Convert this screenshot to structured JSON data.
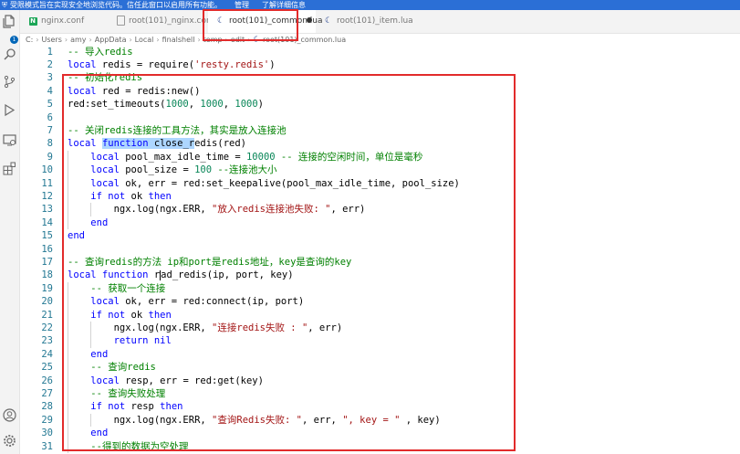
{
  "banner": {
    "message": "受限模式旨在实现安全地浏览代码。信任此窗口以启用所有功能。",
    "manage": "管理",
    "learn_more": "了解详细信息"
  },
  "activity_bar": {
    "badge": "1",
    "icons": [
      "files-icon",
      "search-icon",
      "source-control-icon",
      "run-debug-icon",
      "remote-explorer-icon",
      "extensions-icon",
      "account-icon",
      "settings-gear-icon"
    ]
  },
  "tabs": [
    {
      "label": "nginx.conf",
      "icon": "nginx-icon",
      "active": false
    },
    {
      "label": "root(101)_nginx.conf",
      "icon": "file-icon",
      "active": false
    },
    {
      "label": "root(101)_common.lua",
      "icon": "lua-icon",
      "active": true,
      "modified": true
    },
    {
      "label": "root(101)_item.lua",
      "icon": "lua-icon",
      "active": false
    }
  ],
  "breadcrumb": [
    "C:",
    "Users",
    "amy",
    "AppData",
    "Local",
    "finalshell",
    "temp",
    "edit",
    "root(101)_common.lua"
  ],
  "colors": {
    "annotation": "#e22b2b",
    "comment": "#008000",
    "keyword": "#0000ff",
    "string": "#a31515",
    "number": "#098658"
  },
  "code_lines": [
    {
      "n": "1",
      "segs": [
        [
          "c",
          "-- 导入redis"
        ]
      ]
    },
    {
      "n": "2",
      "segs": [
        [
          "k",
          "local"
        ],
        [
          "p",
          " redis = require("
        ],
        [
          "s",
          "'resty.redis'"
        ],
        [
          "p",
          ")"
        ]
      ]
    },
    {
      "n": "3",
      "segs": [
        [
          "c",
          "-- 初始化redis"
        ]
      ]
    },
    {
      "n": "4",
      "segs": [
        [
          "k",
          "local"
        ],
        [
          "p",
          " red = redis:new()"
        ]
      ]
    },
    {
      "n": "5",
      "segs": [
        [
          "p",
          "red:set_timeouts("
        ],
        [
          "n",
          "1000"
        ],
        [
          "p",
          ", "
        ],
        [
          "n",
          "1000"
        ],
        [
          "p",
          ", "
        ],
        [
          "n",
          "1000"
        ],
        [
          "p",
          ")"
        ]
      ]
    },
    {
      "n": "6",
      "segs": []
    },
    {
      "n": "7",
      "segs": [
        [
          "c",
          "-- 关闭redis连接的工具方法，其实是放入连接池"
        ]
      ]
    },
    {
      "n": "8",
      "segs": [
        [
          "k",
          "local "
        ],
        [
          "kh",
          "function"
        ],
        [
          "ph",
          " close_r"
        ],
        [
          "p",
          "edis(red)"
        ]
      ]
    },
    {
      "n": "9",
      "segs": [
        [
          "p",
          "    "
        ],
        [
          "k",
          "local"
        ],
        [
          "p",
          " pool_max_idle_time = "
        ],
        [
          "n",
          "10000"
        ],
        [
          "p",
          " "
        ],
        [
          "c",
          "-- 连接的空闲时间，单位是毫秒"
        ]
      ]
    },
    {
      "n": "10",
      "segs": [
        [
          "p",
          "    "
        ],
        [
          "k",
          "local"
        ],
        [
          "p",
          " pool_size = "
        ],
        [
          "n",
          "100"
        ],
        [
          "p",
          " "
        ],
        [
          "c",
          "--连接池大小"
        ]
      ]
    },
    {
      "n": "11",
      "segs": [
        [
          "p",
          "    "
        ],
        [
          "k",
          "local"
        ],
        [
          "p",
          " ok, err = red:set_keepalive(pool_max_idle_time, pool_size)"
        ]
      ]
    },
    {
      "n": "12",
      "segs": [
        [
          "p",
          "    "
        ],
        [
          "k",
          "if not"
        ],
        [
          "p",
          " ok "
        ],
        [
          "k",
          "then"
        ]
      ]
    },
    {
      "n": "13",
      "segs": [
        [
          "p",
          "        ngx.log(ngx.ERR, "
        ],
        [
          "s",
          "\"放入redis连接池失败: \""
        ],
        [
          "p",
          ", err)"
        ]
      ]
    },
    {
      "n": "14",
      "segs": [
        [
          "p",
          "    "
        ],
        [
          "k",
          "end"
        ]
      ]
    },
    {
      "n": "15",
      "segs": [
        [
          "k",
          "end"
        ]
      ]
    },
    {
      "n": "16",
      "segs": []
    },
    {
      "n": "17",
      "segs": [
        [
          "c",
          "-- 查询redis的方法 ip和port是redis地址，key是查询的key"
        ]
      ]
    },
    {
      "n": "18",
      "segs": [
        [
          "k",
          "local function"
        ],
        [
          "p",
          " r"
        ],
        [
          "cur",
          ""
        ],
        [
          "p",
          "ad_redis(ip, port, key)"
        ]
      ]
    },
    {
      "n": "19",
      "segs": [
        [
          "p",
          "    "
        ],
        [
          "c",
          "-- 获取一个连接"
        ]
      ]
    },
    {
      "n": "20",
      "segs": [
        [
          "p",
          "    "
        ],
        [
          "k",
          "local"
        ],
        [
          "p",
          " ok, err = red:connect(ip, port)"
        ]
      ]
    },
    {
      "n": "21",
      "segs": [
        [
          "p",
          "    "
        ],
        [
          "k",
          "if not"
        ],
        [
          "p",
          " ok "
        ],
        [
          "k",
          "then"
        ]
      ]
    },
    {
      "n": "22",
      "segs": [
        [
          "p",
          "        ngx.log(ngx.ERR, "
        ],
        [
          "s",
          "\"连接redis失败 : \""
        ],
        [
          "p",
          ", err)"
        ]
      ]
    },
    {
      "n": "23",
      "segs": [
        [
          "p",
          "        "
        ],
        [
          "k",
          "return nil"
        ]
      ]
    },
    {
      "n": "24",
      "segs": [
        [
          "p",
          "    "
        ],
        [
          "k",
          "end"
        ]
      ]
    },
    {
      "n": "25",
      "segs": [
        [
          "p",
          "    "
        ],
        [
          "c",
          "-- 查询redis"
        ]
      ]
    },
    {
      "n": "26",
      "segs": [
        [
          "p",
          "    "
        ],
        [
          "k",
          "local"
        ],
        [
          "p",
          " resp, err = red:get(key)"
        ]
      ]
    },
    {
      "n": "27",
      "segs": [
        [
          "p",
          "    "
        ],
        [
          "c",
          "-- 查询失败处理"
        ]
      ]
    },
    {
      "n": "28",
      "segs": [
        [
          "p",
          "    "
        ],
        [
          "k",
          "if not"
        ],
        [
          "p",
          " resp "
        ],
        [
          "k",
          "then"
        ]
      ]
    },
    {
      "n": "29",
      "segs": [
        [
          "p",
          "        ngx.log(ngx.ERR, "
        ],
        [
          "s",
          "\"查询Redis失败: \""
        ],
        [
          "p",
          ", err, "
        ],
        [
          "s",
          "\", key = \""
        ],
        [
          "p",
          " , key)"
        ]
      ]
    },
    {
      "n": "30",
      "segs": [
        [
          "p",
          "    "
        ],
        [
          "k",
          "end"
        ]
      ]
    },
    {
      "n": "31",
      "segs": [
        [
          "p",
          "    "
        ],
        [
          "c",
          "--得到的数据为空处理"
        ]
      ]
    }
  ]
}
